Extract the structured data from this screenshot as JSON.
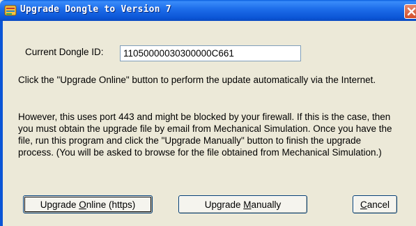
{
  "window": {
    "title": "Upgrade Dongle to Version 7",
    "close_symbol": "✕"
  },
  "dongle": {
    "label": "Current Dongle ID:",
    "value": "11050000030300000C661"
  },
  "text": {
    "para1": "Click the \"Upgrade Online\" button to perform the update automatically via the Internet.",
    "para2": "However, this uses port 443 and might be blocked by your firewall. If this is the case, then you must obtain the upgrade file by email from Mechanical Simulation. Once you have the file, run this program and click the \"Upgrade Manually\" button to finish the upgrade process. (You will be asked to browse for the file obtained from Mechanical Simulation.)"
  },
  "buttons": {
    "online_pre": "Upgrade ",
    "online_key": "O",
    "online_post": "nline (https)",
    "manual_pre": "Upgrade ",
    "manual_key": "M",
    "manual_post": "anually",
    "cancel_key": "C",
    "cancel_post": "ancel"
  },
  "icons": {
    "app": "app-icon",
    "close": "close-icon"
  }
}
